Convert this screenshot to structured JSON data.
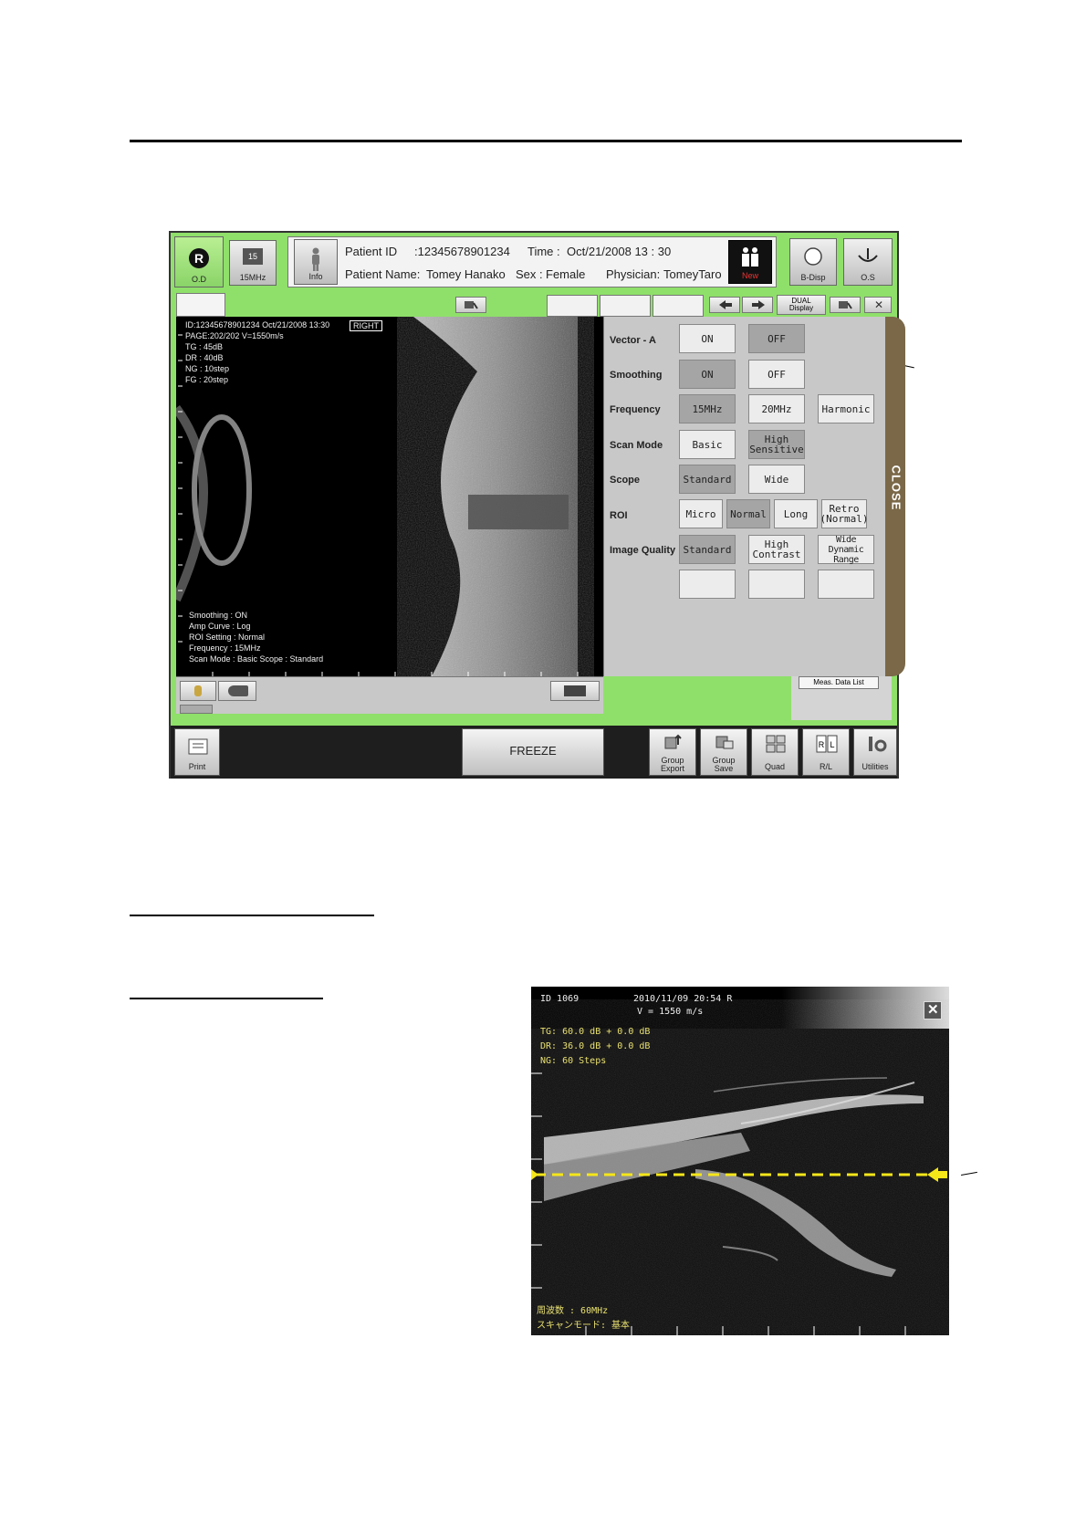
{
  "topbar": {
    "od_label": "O.D",
    "freq_badge": "15",
    "freq_label": "15MHz",
    "info_label": "Info",
    "patient_id_label": "Patient ID",
    "patient_id_value": ":12345678901234",
    "time_label": "Time :",
    "time_value": "Oct/21/2008   13 : 30",
    "patient_name_label": "Patient Name:",
    "patient_name_value": "Tomey Hanako",
    "sex_label": "Sex :",
    "sex_value": "Female",
    "physician_label": "Physician:",
    "physician_value": "TomeyTaro",
    "new_label": "New",
    "bdisp_label": "B-Disp",
    "os_label": "O.S"
  },
  "tabbar": {
    "dual_display": "DUAL\nDisplay"
  },
  "image_overlay": {
    "header": "ID:12345678901234 Oct/21/2008 13:30",
    "eye_badge": "RIGHT",
    "page": "PAGE:202/202 V=1550m/s",
    "tg": "TG  : 45dB",
    "dr": "DR  : 40dB",
    "ng": "NG  : 10step",
    "fg": "FG  : 20step",
    "smoothing": "Smoothing      : ON",
    "amp_curve": "Amp Curve     : Log",
    "roi_setting": "ROI Setting    : Normal",
    "frequency": "Frequency      : 15MHz",
    "scan_mode": "Scan Mode     : Basic      Scope    : Standard"
  },
  "controls": {
    "vector_a": {
      "label": "Vector - A",
      "on": "ON",
      "off": "OFF"
    },
    "smoothing": {
      "label": "Smoothing",
      "on": "ON",
      "off": "OFF"
    },
    "frequency": {
      "label": "Frequency",
      "opt1": "15MHz",
      "opt2": "20MHz",
      "opt3": "Harmonic"
    },
    "scan_mode": {
      "label": "Scan Mode",
      "opt1": "Basic",
      "opt2": "High\nSensitive"
    },
    "scope": {
      "label": "Scope",
      "opt1": "Standard",
      "opt2": "Wide"
    },
    "roi": {
      "label": "ROI",
      "opt1": "Micro",
      "opt2": "Normal",
      "opt3": "Long",
      "opt4": "Retro\n(Normal)"
    },
    "image_quality": {
      "label": "Image Quality",
      "opt1": "Standard",
      "opt2": "High\nContrast",
      "opt3": "Wide Dynamic\nRange"
    },
    "close": "CLOSE",
    "meas_data_list": "Meas. Data List"
  },
  "bottom_bar": {
    "print": "Print",
    "freeze": "FREEZE",
    "group_export": "Group\nExport",
    "group_save": "Group\nSave",
    "quad": "Quad",
    "rl": "R/L",
    "utilities": "Utilities"
  },
  "second_image": {
    "id": "ID  1069",
    "datetime": "2010/11/09  20:54  R",
    "velocity": "V =  1550  m/s",
    "tg": "TG:   60.0 dB + 0.0  dB",
    "dr": "DR:   36.0 dB + 0.0  dB",
    "ng": "NG:   60   Steps",
    "freq": "周波数         : 60MHz",
    "scan_mode": "スキャンモード:  基本"
  },
  "colors": {
    "panel_green": "#8fe06a",
    "od_green": "#9be070",
    "close_tab": "#7a6848",
    "scan_line": "#f5e61a"
  }
}
